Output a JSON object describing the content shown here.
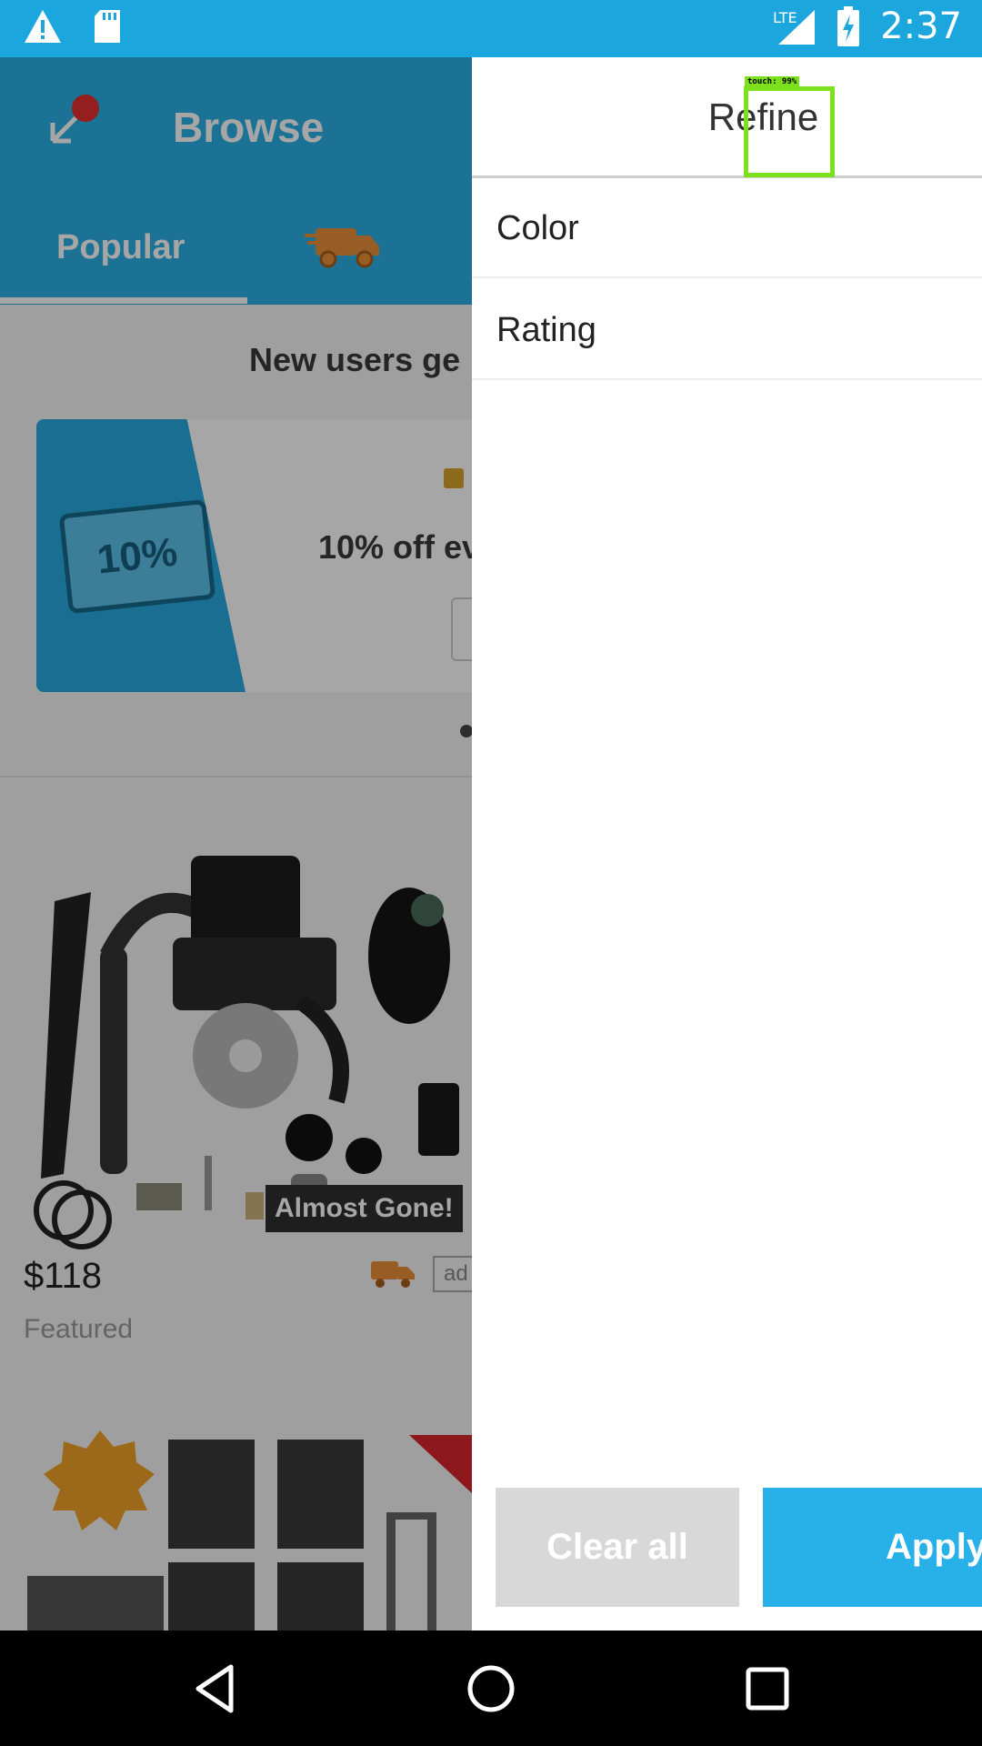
{
  "status_bar": {
    "time": "2:37",
    "network": "LTE",
    "icons": [
      "warning-icon",
      "sd-card-icon",
      "signal-icon",
      "battery-charging-icon"
    ]
  },
  "background_screen": {
    "title": "Browse",
    "tabs": [
      "Popular"
    ],
    "promo_heading": "New users ge",
    "promo_ticket": "10%",
    "promo_text": "10% off ev",
    "product": {
      "badge": "Almost Gone!",
      "price": "$118",
      "label": "Featured",
      "ad_label": "ad"
    }
  },
  "drawer": {
    "title": "Refine",
    "filters": [
      "Color",
      "Rating"
    ],
    "clear_label": "Clear all",
    "apply_label": "Apply"
  },
  "overlay": {
    "touch_label": "touch: 99%"
  },
  "nav_bar": {
    "icons": [
      "back-icon",
      "home-icon",
      "recents-icon"
    ]
  },
  "colors": {
    "accent": "#28b0e8",
    "status_bar": "#1ba6dd",
    "touch_marker": "#7ce11c"
  }
}
